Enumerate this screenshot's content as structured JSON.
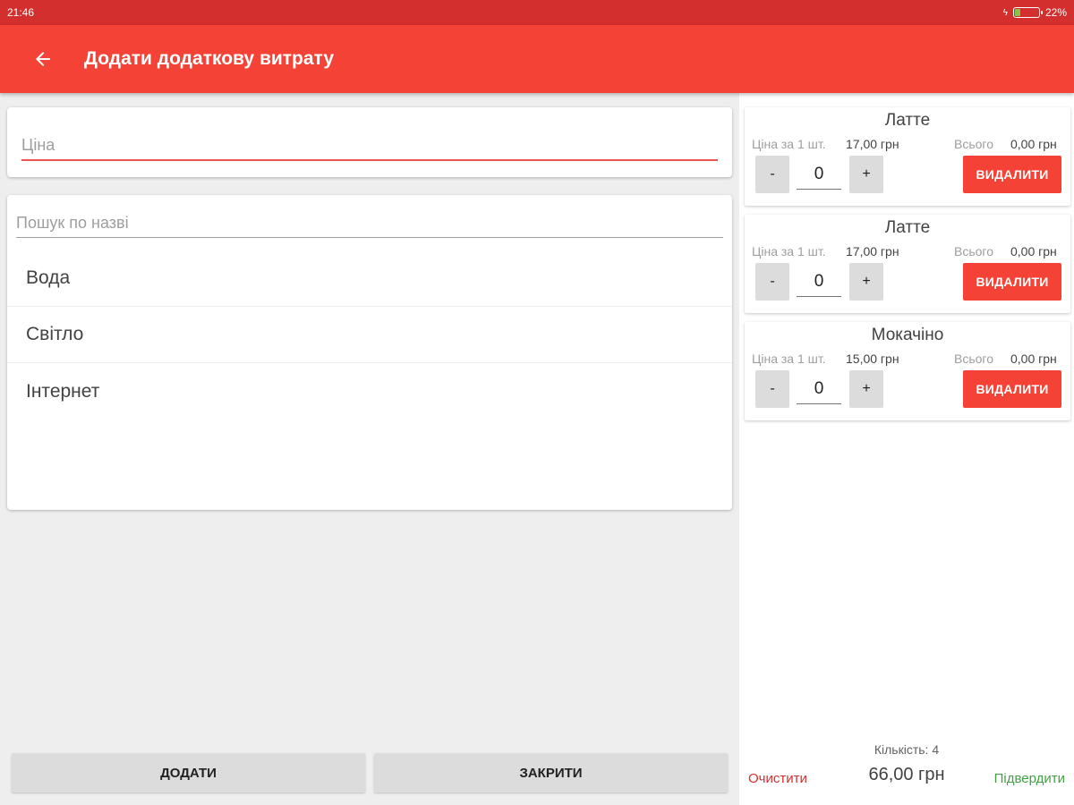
{
  "status_bar": {
    "time": "21:46",
    "battery_percent": "22%",
    "battery_level": 0.22,
    "bar_color": "#d32f2f"
  },
  "app_bar": {
    "title": "Додати додаткову витрату",
    "color": "#f44336",
    "back_icon": "arrow-left-icon"
  },
  "price_field": {
    "placeholder": "Ціна",
    "value": ""
  },
  "search": {
    "placeholder": "Пошук по назві",
    "value": ""
  },
  "expense_items": [
    {
      "label": "Вода"
    },
    {
      "label": "Світло"
    },
    {
      "label": "Інтернет"
    }
  ],
  "actions": {
    "add_label": "ДОДАТИ",
    "close_label": "ЗАКРИТИ"
  },
  "order": {
    "unit_label": "Ціна за 1 шт.",
    "total_label": "Всього",
    "delete_label": "ВИДАЛИТИ",
    "minus_label": "-",
    "plus_label": "+",
    "items": [
      {
        "name": "Латте",
        "unit_price": "17,00 грн",
        "total": "0,00 грн",
        "quantity": "0"
      },
      {
        "name": "Латте",
        "unit_price": "17,00 грн",
        "total": "0,00 грн",
        "quantity": "0"
      },
      {
        "name": "Мокачіно",
        "unit_price": "15,00 грн",
        "total": "0,00 грн",
        "quantity": "0"
      }
    ]
  },
  "footer": {
    "clear_label": "Очистити",
    "quantity_text": "Кількість: 4",
    "total_text": "66,00 грн",
    "confirm_label": "Підвердити",
    "clear_color": "#d32f2f",
    "confirm_color": "#43a047"
  }
}
